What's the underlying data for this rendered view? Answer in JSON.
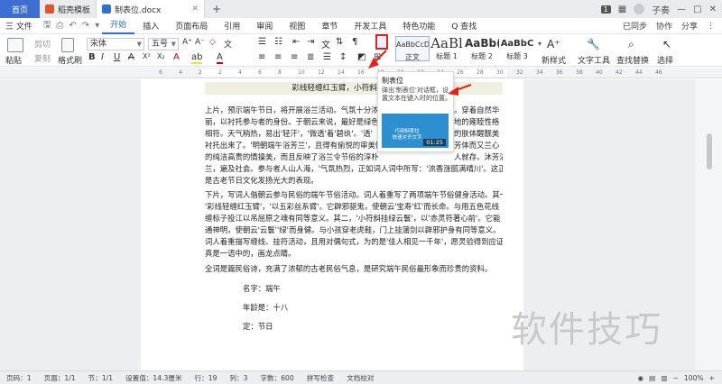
{
  "titlebar": {
    "home_tab": "首页",
    "tabs": [
      {
        "label": "稻壳模板",
        "color": "#e2542f"
      },
      {
        "label": "制表位.docx",
        "color": "#2f6fd9"
      }
    ],
    "add_label": "+",
    "right": {
      "badge": "1",
      "user": "子奏"
    }
  },
  "menubar": {
    "file": "三 文件",
    "items": [
      "开始",
      "插入",
      "页面布局",
      "引用",
      "审阅",
      "视图",
      "章节",
      "开发工具",
      "特色功能",
      "Q 查找"
    ],
    "active": "开始",
    "right": [
      "已同步",
      "协作",
      "分享"
    ]
  },
  "ribbon": {
    "paste": "粘贴",
    "cut": "剪切",
    "copy": "复制",
    "format_painter": "格式刷",
    "font_name": "宋体",
    "font_size": "五号",
    "bold": "B",
    "italic": "I",
    "underline": "U",
    "font_color": "A",
    "styles": [
      {
        "preview": "AaBbCcDd",
        "label": "正文"
      },
      {
        "preview": "AaBl",
        "label": "标题 1"
      },
      {
        "preview": "AaBb(",
        "label": "标题 2"
      },
      {
        "preview": "AaBbC",
        "label": "标题 3"
      }
    ],
    "new_style": "新样式",
    "text_tools": "文字工具",
    "find_replace": "查找替换",
    "select": "选择"
  },
  "ruler": {
    "ticks": [
      "6",
      "4",
      "2",
      "2",
      "4",
      "6",
      "8",
      "10",
      "12",
      "14",
      "16",
      "18",
      "20",
      "22",
      "24",
      "26",
      "28",
      "30",
      "32",
      "34",
      "36",
      "38",
      "40",
      "42",
      "44",
      "46"
    ]
  },
  "document": {
    "title": "彩线轻缠红玉臂，小符斜挂绿云鬟，",
    "para1": [
      "上片，预示端午节日，将开展浴兰活动。气氛十分浓",
      "丽，以衬托参与者的身份。于朝云来说，最好是绿色",
      "相符。天气稍热，易出'轻汗'，'微透'着'碧纨'。'透'",
      "衬托出来了。'明朝端午浴芳兰'，且得有偷悦的审美情",
      "的纯洁高贵的情操美，而且反映了浴兰令节俗的淳朴",
      "兰，遍及社会。参与者人山人海，'气氛热烈，正如词人词中所写：'流香涨腻满晴川'。这正",
      "是古老节日文化发扬光大的表现。"
    ],
    "para1_right": [
      "。穿着自然华",
      "地的雍睦性格",
      "的肤体醒靓美",
      "芳体而又兰心",
      "人就存。沐芳浴",
      "",
      ""
    ],
    "para2": [
      "下片，写词人偕朝云参与民俗的端午节俗活动。词人着重写了两项端午节俗健身活动。其一，",
      "'彩线轻缠红玉臂'，'以五彩丝系臂'。它辟邪驱鬼，使朝云'宝寿'红'而长命。与用五色花线",
      "缠标子投江以吊屈原之魂有同等意义。其二，'小符斜挂绿云鬟'，以'赤灵符著心前'。它能",
      "通神明，使朝云'云鬟''绿'而身健。与小孩穿老虎鞋，门上挂蒲剑以辟邪护身有同等意义。",
      "词人着重描写缠线、挂符活动，且用对偶句式，为的是'佳人相见一千年'，愿灵验得到应证。",
      "真是一语中的，画龙点睛。"
    ],
    "para3": "全词是篇民俗诗，充满了浓郁的古老民俗气息，是研究端午民俗最形象而珍贵的资料。",
    "info": [
      "名字：端午",
      "年龄是：十八",
      "定：节日"
    ]
  },
  "tooltip": {
    "title": "制表位",
    "desc": "弹出'制表位'对话框，设置文本在键入时的位置。",
    "video_line1": "巧用制表位",
    "video_line2": "快速对齐文字",
    "time": "01:25",
    "video_color": "#2e8fd0"
  },
  "watermark": "软件技巧",
  "statusbar": {
    "items": [
      "页码：1",
      "页面：1/1",
      "节：1/1",
      "设置值：14.3厘米",
      "行：19",
      "列：3",
      "字数：600",
      "拼写检查",
      "文档校对"
    ],
    "zoom": "100%"
  },
  "colors": {
    "accent": "#2f6fd9",
    "highlight": "#e0231b"
  }
}
